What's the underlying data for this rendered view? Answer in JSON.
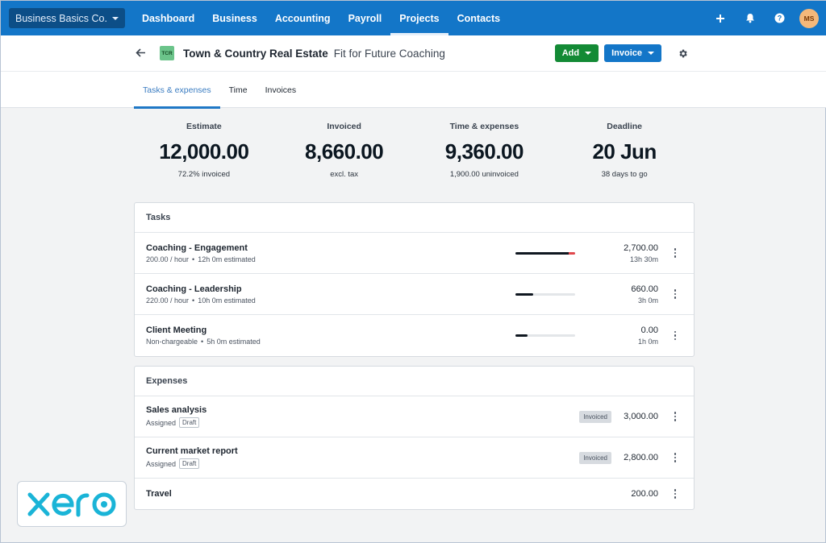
{
  "topnav": {
    "org": "Business Basics Co.",
    "items": [
      {
        "label": "Dashboard",
        "active": false
      },
      {
        "label": "Business",
        "active": false
      },
      {
        "label": "Accounting",
        "active": false
      },
      {
        "label": "Payroll",
        "active": false
      },
      {
        "label": "Projects",
        "active": true
      },
      {
        "label": "Contacts",
        "active": false
      }
    ],
    "icons": [
      "plus-icon",
      "bell-icon",
      "help-icon"
    ],
    "avatar_initials": "MS"
  },
  "header": {
    "org_badge": "TCR",
    "client_name": "Town & Country Real Estate",
    "project_name": "Fit for Future Coaching",
    "add_label": "Add",
    "invoice_label": "Invoice",
    "colors": {
      "add": "#138a35",
      "invoice": "#1376c8",
      "nav": "#1376c8"
    }
  },
  "tabs": [
    {
      "label": "Tasks & expenses",
      "active": true
    },
    {
      "label": "Time",
      "active": false
    },
    {
      "label": "Invoices",
      "active": false
    }
  ],
  "stats": [
    {
      "label": "Estimate",
      "value": "12,000.00",
      "sub": "72.2% invoiced"
    },
    {
      "label": "Invoiced",
      "value": "8,660.00",
      "sub": "excl. tax"
    },
    {
      "label": "Time & expenses",
      "value": "9,360.00",
      "sub": "1,900.00 uninvoiced"
    },
    {
      "label": "Deadline",
      "value": "20 Jun",
      "sub": "38 days to go"
    }
  ],
  "tasks": {
    "title": "Tasks",
    "rows": [
      {
        "name": "Coaching - Engagement",
        "rate": "200.00 / hour",
        "estimate": "12h 0m estimated",
        "amount": "2,700.00",
        "time": "13h 30m",
        "progress": 1.125
      },
      {
        "name": "Coaching - Leadership",
        "rate": "220.00 / hour",
        "estimate": "10h 0m estimated",
        "amount": "660.00",
        "time": "3h 0m",
        "progress": 0.3
      },
      {
        "name": "Client Meeting",
        "rate": "Non-chargeable",
        "estimate": "5h 0m estimated",
        "amount": "0.00",
        "time": "1h 0m",
        "progress": 0.2
      }
    ]
  },
  "expenses": {
    "title": "Expenses",
    "rows": [
      {
        "name": "Sales analysis",
        "assigned": "Assigned",
        "draft": "Draft",
        "status": "Invoiced",
        "amount": "3,000.00"
      },
      {
        "name": "Current market report",
        "assigned": "Assigned",
        "draft": "Draft",
        "status": "Invoiced",
        "amount": "2,800.00"
      },
      {
        "name": "Travel",
        "amount": "200.00"
      }
    ]
  },
  "logo": {
    "text": "xero",
    "color": "#1ab4d7"
  }
}
